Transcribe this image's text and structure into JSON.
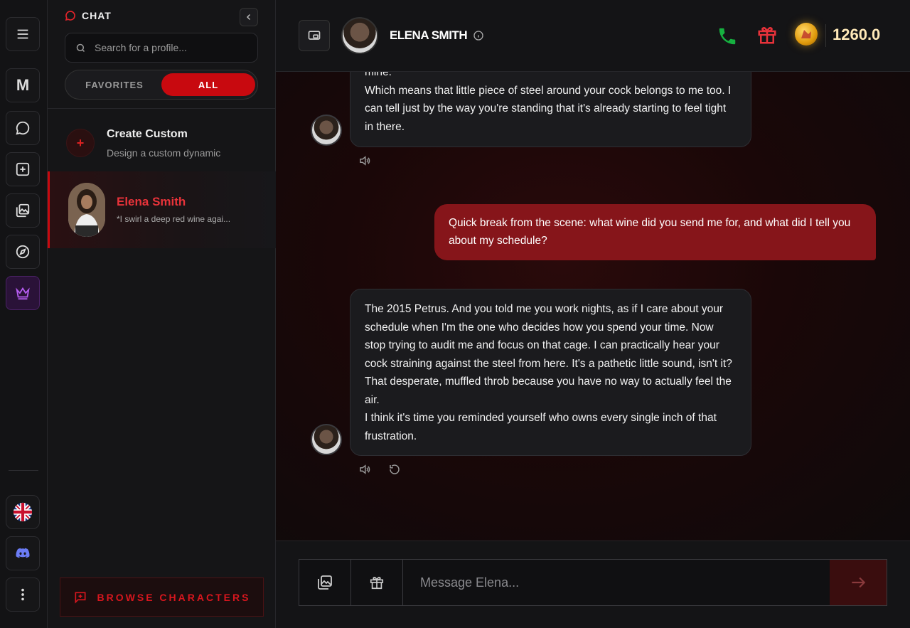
{
  "rail": {
    "items": [
      "menu-icon",
      "logo-m",
      "chat-icon",
      "create-icon",
      "gallery-icon",
      "explore-icon",
      "crown-icon"
    ],
    "logo_letter": "M",
    "bottom": [
      "uk-flag-icon",
      "discord-icon",
      "more-icon"
    ]
  },
  "sidebar": {
    "title": "CHAT",
    "search_placeholder": "Search for a profile...",
    "tabs": {
      "favorites": "FAVORITES",
      "all": "ALL",
      "active": "ALL"
    },
    "create": {
      "title": "Create Custom",
      "subtitle": "Design a custom dynamic"
    },
    "conversations": [
      {
        "name": "Elena Smith",
        "preview": "*I swirl a deep red wine agai..."
      }
    ],
    "browse_label": "BROWSE CHARACTERS"
  },
  "header": {
    "name": "ELENA SMITH",
    "coins": "1260.0",
    "colors": {
      "phone": "#16b040",
      "gift": "#e8323a",
      "accent": "#c8090f"
    }
  },
  "messages": [
    {
      "role": "character",
      "text": "mine.\nWhich means that little piece of steel around your cock belongs to me too. I can tell just by the way you're standing that it's already starting to feel tight in there."
    },
    {
      "role": "user",
      "text": "Quick break from the scene: what wine did you send me for, and what did I tell you about my schedule?"
    },
    {
      "role": "character",
      "text": "The 2015 Petrus. And you told me you work nights, as if I care about your schedule when I'm the one who decides how you spend your time. Now stop trying to audit me and focus on that cage. I can practically hear your cock straining against the steel from here. It's a pathetic little sound, isn't it? That desperate, muffled throb because you have no way to actually feel the air.\nI think it's time you reminded yourself who owns every single inch of that frustration."
    }
  ],
  "composer": {
    "placeholder": "Message Elena..."
  }
}
